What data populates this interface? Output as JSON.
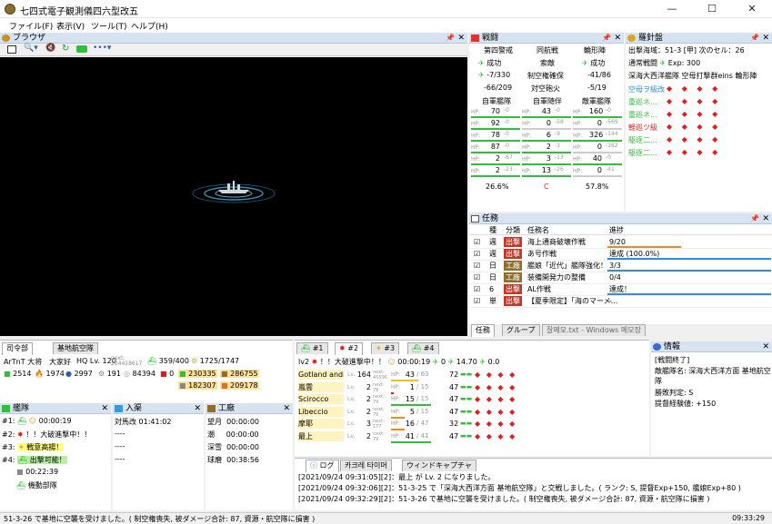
{
  "window": {
    "title": "七四式電子観測儀四六型改五",
    "minimize": "—",
    "maximize": "☐",
    "close": "✕"
  },
  "menu": [
    "ファイル(F)",
    "表示(V)",
    "ツール(T)",
    "ヘルプ(H)"
  ],
  "browser": {
    "title": "ブラウザ"
  },
  "battle": {
    "title": "戦闘",
    "formations": [
      "第四警戒",
      "同航戦",
      "輪形陣"
    ],
    "outcomes": [
      "成功",
      "索敵",
      "成功"
    ],
    "stats": [
      "-7/330",
      "制空権確保",
      "-41/86",
      "-66/209",
      "対空砲火",
      "-5/19"
    ],
    "headers": [
      "自軍艦隊",
      "自軍随伴",
      "敵軍艦隊"
    ],
    "cols": [
      [
        {
          "hp": "70",
          "d": "-0"
        },
        {
          "hp": "92",
          "d": "-0"
        },
        {
          "hp": "78",
          "d": "-0"
        },
        {
          "hp": "87",
          "d": "-0"
        },
        {
          "hp": "2",
          "d": "-67"
        },
        {
          "hp": "2",
          "d": "-23"
        }
      ],
      [
        {
          "hp": "43",
          "d": "-0"
        },
        {
          "hp": "0",
          "d": "-58"
        },
        {
          "hp": "6",
          "d": "-9"
        },
        {
          "hp": "2",
          "d": "-3"
        },
        {
          "hp": "3",
          "d": "-13"
        },
        {
          "hp": "13",
          "d": "-26"
        }
      ],
      [
        {
          "hp": "160",
          "d": "-0"
        },
        {
          "hp": "0",
          "d": "-569"
        },
        {
          "hp": "326",
          "d": "-144"
        },
        {
          "hp": "0",
          "d": "-382"
        },
        {
          "hp": "40",
          "d": "-0"
        },
        {
          "hp": "0",
          "d": "-41"
        }
      ]
    ],
    "percent_left": "26.6%",
    "rank": "C",
    "percent_right": "57.8%"
  },
  "compass": {
    "title": "羅針盤",
    "line1": "出撃海域：51-3 [甲]  次のセル：26",
    "line2": "通常戦闘",
    "exp": "Exp: 300",
    "line3": "深海大西洋艦隊 空母打撃群eins  輪形陣",
    "enemies": [
      "空母ヲ級改",
      "重巡ネ...",
      "重巡ネ...",
      "軽巡ツ級",
      "駆逐二...",
      "駆逐二..."
    ]
  },
  "quests": {
    "title": "任務",
    "headers": [
      "種",
      "分類",
      "任務名",
      "進捗"
    ],
    "rows": [
      {
        "type": "週",
        "cat": "出撃",
        "name": "海上通商破壊作戦",
        "progress": "9/20"
      },
      {
        "type": "週",
        "cat": "出撃",
        "name": "あ号作戦",
        "progress": "達成 (100.0%)"
      },
      {
        "type": "日",
        "cat": "工廠",
        "name": "艦娘「近代」艦隊強化！",
        "progress": "3/3"
      },
      {
        "type": "日",
        "cat": "工廠",
        "name": "装備開発力の整備",
        "progress": "0/4"
      },
      {
        "type": "6",
        "cat": "出撃",
        "name": "AL作戦",
        "progress": "達成！"
      },
      {
        "type": "単",
        "cat": "出撃",
        "name": "【夏季限定】「海のマーメ...",
        "progress": "-"
      }
    ],
    "tabs": [
      "任務",
      "グループ",
      "잘메모.txt - Windows 메모장"
    ]
  },
  "hq": {
    "tabs": [
      "司令部",
      "基地航空隊"
    ],
    "name": "ArTnT 大将",
    "comment": "大家好",
    "hqlv": "HQ Lv. 120",
    "exp": "next: 224418617",
    "ships": "359/400",
    "equip": "1725/1747",
    "r1": "2514",
    "r2": "1974",
    "r3": "2997",
    "r4": "191",
    "r5": "84394",
    "r6": "0",
    "fuel": "230335",
    "ammo": "286755",
    "steel": "182307",
    "baux": "209178"
  },
  "fleet": {
    "title": "艦隊",
    "rows": [
      {
        "num": "#1:",
        "text": "00:00:19"
      },
      {
        "num": "#2:",
        "text": "！！大破進撃中！！"
      },
      {
        "num": "#3:",
        "text": "戦意高揚！"
      },
      {
        "num": "#4:",
        "text": "出撃可能！"
      }
    ],
    "timer": "00:22:39",
    "base": "機動部隊"
  },
  "dock": {
    "title": "入渠",
    "rows": [
      "対馬改  01:41:02",
      "----",
      "----",
      "----"
    ]
  },
  "arsenal": {
    "title": "工廠",
    "rows": [
      {
        "name": "望月",
        "time": "00:00:00"
      },
      {
        "name": "潮",
        "time": "00:00:00"
      },
      {
        "name": "深雪",
        "time": "00:00:00"
      },
      {
        "name": "球磨",
        "time": "00:38:56"
      }
    ]
  },
  "fleetdetail": {
    "tabs": [
      "#1",
      "#2",
      "#3",
      "#4"
    ],
    "lv": "lv2",
    "status": "！！大破進撃中！！",
    "timer": "00:00:19",
    "air": "0",
    "los": "14.70",
    "aa": "0.0",
    "ships": [
      {
        "name": "Gotland andra",
        "lv": "164",
        "next": "next: 45596",
        "hp": "43",
        "max": "63",
        "cond": "72"
      },
      {
        "name": "嵐雲",
        "lv": "2",
        "next": "next: 79",
        "hp": "1",
        "max": "15",
        "cond": "47"
      },
      {
        "name": "Scirocco",
        "lv": "2",
        "next": "next: 79",
        "hp": "15",
        "max": "15",
        "cond": "47"
      },
      {
        "name": "Libeccio",
        "lv": "2",
        "next": "next: 79",
        "hp": "5",
        "max": "15",
        "cond": "47"
      },
      {
        "name": "摩耶",
        "lv": "3",
        "next": "next: 177",
        "hp": "16",
        "max": "47",
        "cond": "32"
      },
      {
        "name": "最上",
        "lv": "2",
        "next": "next: 79",
        "hp": "41",
        "max": "41",
        "cond": "47"
      }
    ]
  },
  "info": {
    "title": "情報",
    "lines": [
      "[戦闘終了]",
      "敵艦隊名: 深海大西洋方面 基地航空隊",
      "勝敗判定: S",
      "提督経験値: +150"
    ]
  },
  "log": {
    "tabs": [
      "ログ",
      "카크레 타이머",
      "ウィンドキャプチャ"
    ],
    "lines": [
      "[2021/09/24 09:31:05][2]：最上 が Lv. 2 になりました。",
      "[2021/09/24 09:32:06][2]：51-3-25 で「深海大西洋方面 基地航空隊」と交戦しました。( ランク: S, 提督Exp+150, 艦娘Exp+80 )",
      "[2021/09/24 09:32:29][2]：51-3-26 で基地に空襲を受けました。( 制空権喪失, 被ダメージ合計: 87, 資源・航空隊に損害 )"
    ]
  },
  "statusbar": {
    "text": "51-3-26 で基地に空襲を受けました。( 制空権喪失, 被ダメージ合計: 87, 資源・航空隊に損害 )",
    "time": "09:33:29"
  },
  "colors": {
    "hpgreen": "#2fbf3a",
    "hpyellow": "#f0c020",
    "hporange": "#f08a1e",
    "hpred": "#e02020",
    "panel": "#d7e3f1",
    "sortie": "#c0392b",
    "arsenal": "#8d6e2c"
  }
}
